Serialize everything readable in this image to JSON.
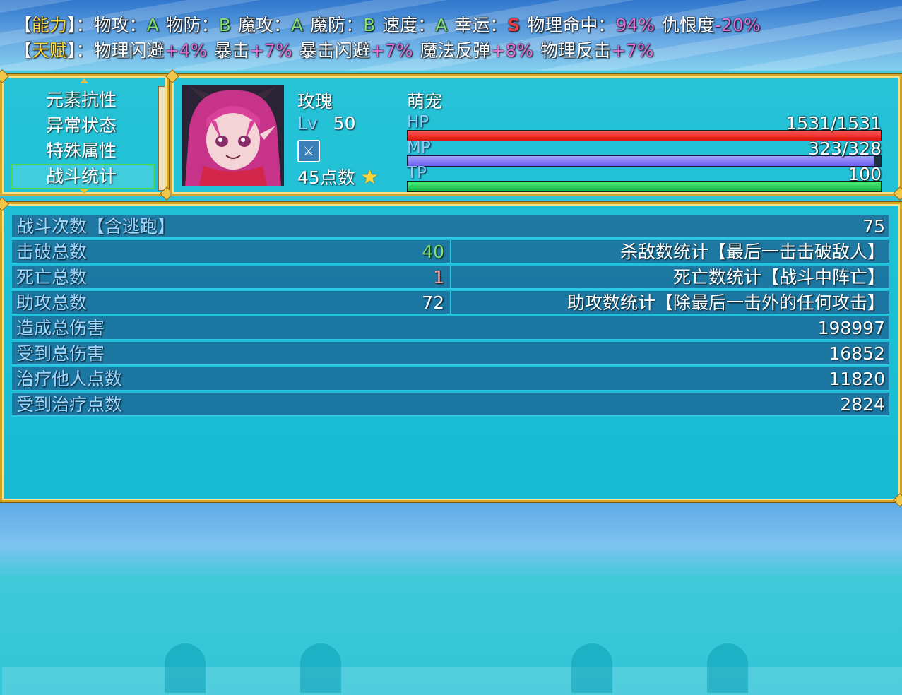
{
  "attributes_line": {
    "bracket_open": "【",
    "title": "能力",
    "bracket_close": "】：",
    "items": [
      {
        "label": "物攻：",
        "value": "A"
      },
      {
        "label": "物防：",
        "value": "B"
      },
      {
        "label": "魔攻：",
        "value": "A"
      },
      {
        "label": "魔防：",
        "value": "B"
      },
      {
        "label": "速度：",
        "value": "A"
      },
      {
        "label": "幸运：",
        "value": "S"
      },
      {
        "label": "物理命中：",
        "value": "94%"
      },
      {
        "label": "仇恨度",
        "value": "-20%"
      }
    ]
  },
  "talent_line": {
    "bracket_open": "【",
    "title": "天赋",
    "bracket_close": "】：",
    "items": [
      {
        "label": "物理闪避",
        "value": "+4%"
      },
      {
        "label": "暴击",
        "value": "+7%"
      },
      {
        "label": "暴击闪避",
        "value": "+7%"
      },
      {
        "label": "魔法反弹",
        "value": "+8%"
      },
      {
        "label": "物理反击",
        "value": "+7%"
      }
    ]
  },
  "command_menu": {
    "items": [
      "元素抗性",
      "异常状态",
      "特殊属性",
      "战斗统计"
    ],
    "selected_index": 3
  },
  "actor": {
    "name": "玫瑰",
    "class": "萌宠",
    "level_label": "Lv",
    "level": "50",
    "points": "45点数",
    "hp_label": "HP",
    "hp_value": "1531/1531",
    "hp_fraction": 1.0,
    "mp_label": "MP",
    "mp_value": "323/328",
    "mp_fraction": 0.985,
    "tp_label": "TP",
    "tp_value": "100",
    "tp_fraction": 1.0
  },
  "battle_stats": [
    {
      "label": "战斗次数【含逃跑】",
      "value": "75"
    },
    {
      "label": "击破总数",
      "value": "40",
      "desc": "杀敌数统计【最后一击击破敌人】",
      "value_color": "#7fe26a"
    },
    {
      "label": "死亡总数",
      "value": "1",
      "desc": "死亡数统计【战斗中阵亡】",
      "value_color": "#f2a0a0"
    },
    {
      "label": "助攻总数",
      "value": "72",
      "desc": "助攻数统计【除最后一击外的任何攻击】",
      "value_color": "#ffffff"
    },
    {
      "label": "造成总伤害",
      "value": "198997"
    },
    {
      "label": "受到总伤害",
      "value": "16852"
    },
    {
      "label": "治疗他人点数",
      "value": "11820"
    },
    {
      "label": "受到治疗点数",
      "value": "2824"
    }
  ],
  "colors": {
    "hp": "#ff2a2a",
    "mp": "#8a7fff",
    "tp": "#22d45a",
    "frame_gold": "#d7a526"
  }
}
